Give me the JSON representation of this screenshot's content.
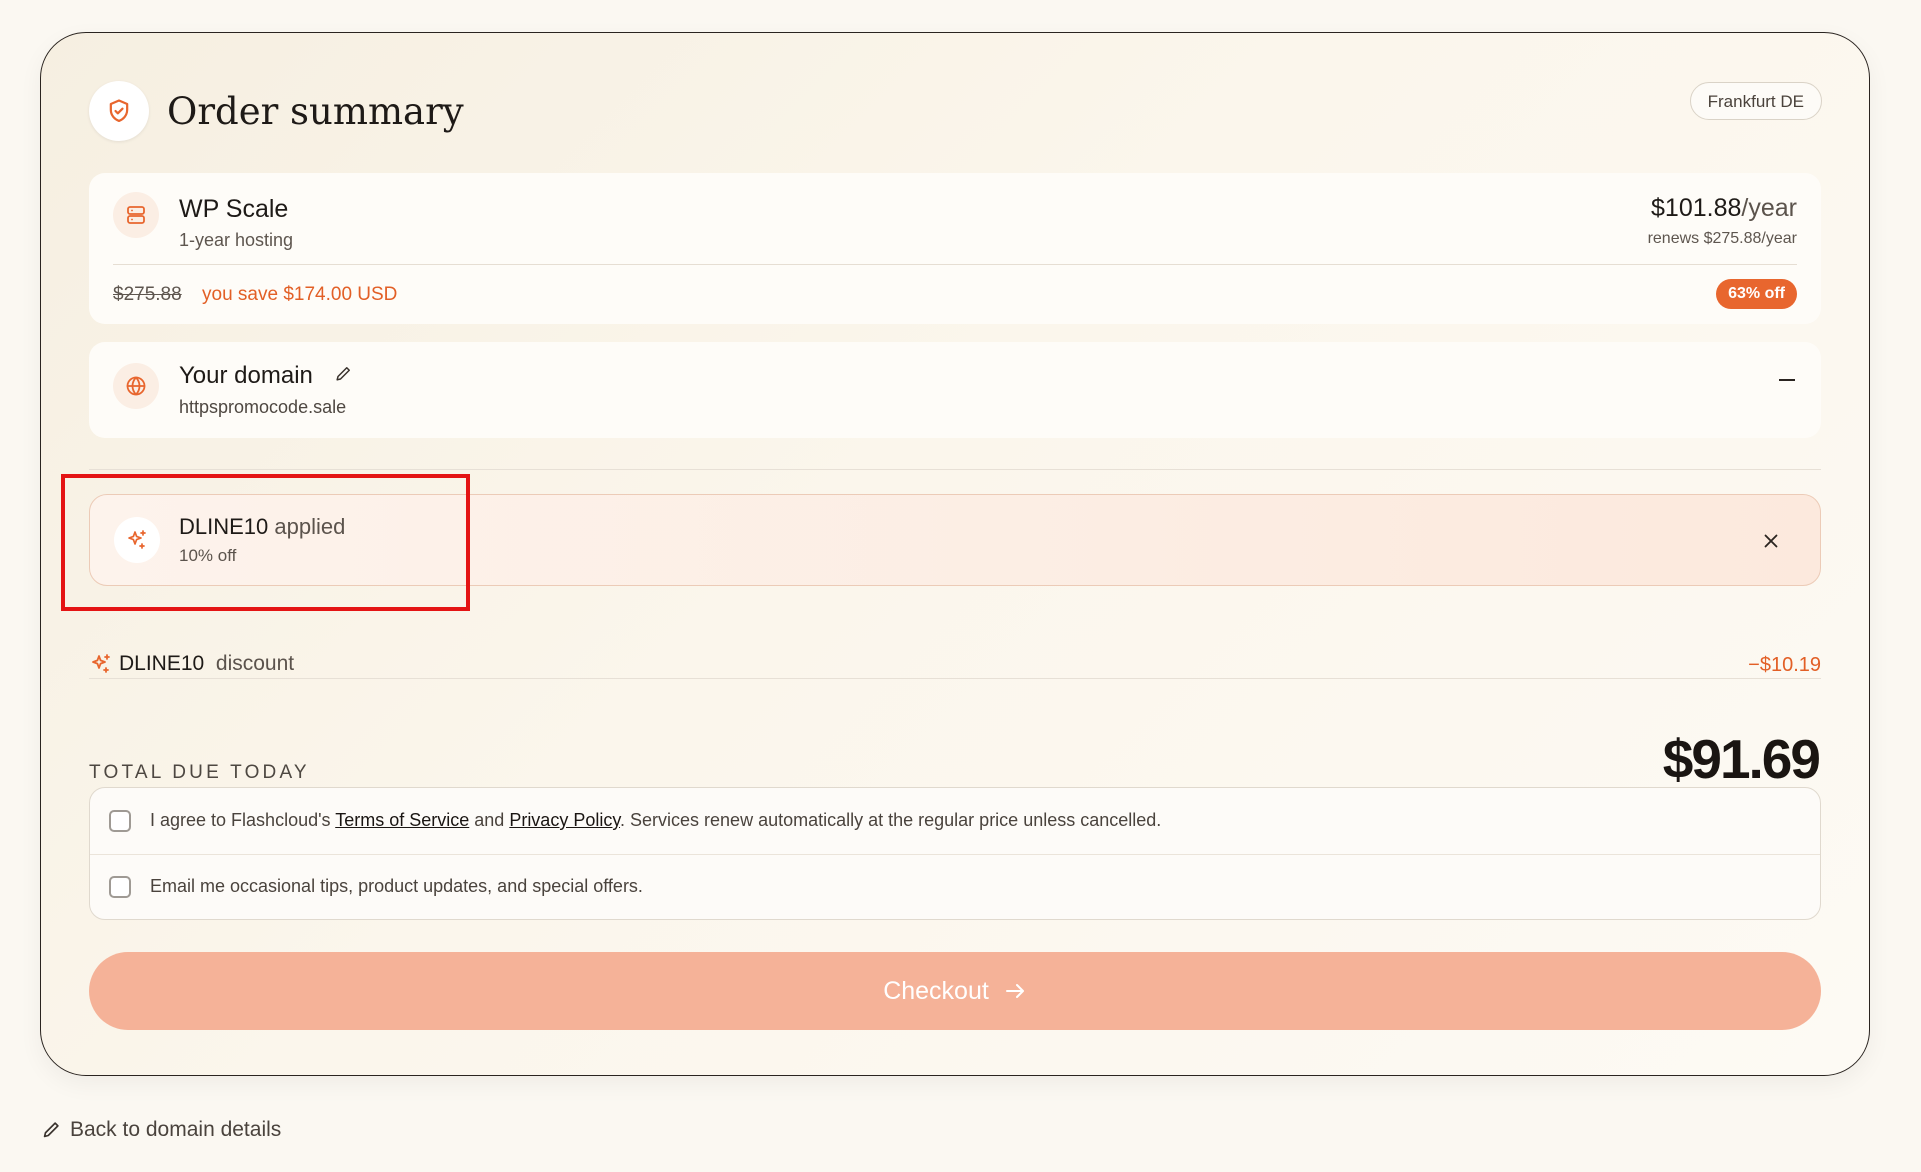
{
  "header": {
    "title": "Order summary",
    "region": "Frankfurt DE"
  },
  "plan": {
    "name": "WP Scale",
    "term": "1-year hosting",
    "price": "$101.88",
    "period": "/year",
    "renews": "renews $275.88/year",
    "original_price": "$275.88",
    "savings": "you save $174.00 USD",
    "discount_badge": "63% off"
  },
  "domain": {
    "title": "Your domain",
    "name": "httpspromocode.sale"
  },
  "promo": {
    "code": "DLINE10",
    "status": "applied",
    "detail": "10% off"
  },
  "discount_line": {
    "code": "DLINE10",
    "label": "discount",
    "amount": "−$10.19"
  },
  "total": {
    "label": "TOTAL DUE TODAY",
    "amount": "$91.69"
  },
  "agreements": {
    "terms_prefix": "I agree to Flashcloud's ",
    "terms_link": "Terms of Service",
    "terms_and": " and ",
    "privacy_link": "Privacy Policy",
    "terms_suffix": ". Services renew automatically at the regular price unless cancelled.",
    "marketing": "Email me occasional tips, product updates, and special offers."
  },
  "checkout": {
    "label": "Checkout"
  },
  "footer": {
    "back_label": "Back to domain details"
  },
  "colors": {
    "accent": "#e8662e",
    "checkout_bg": "#f5b298",
    "highlight": "#e41414"
  }
}
